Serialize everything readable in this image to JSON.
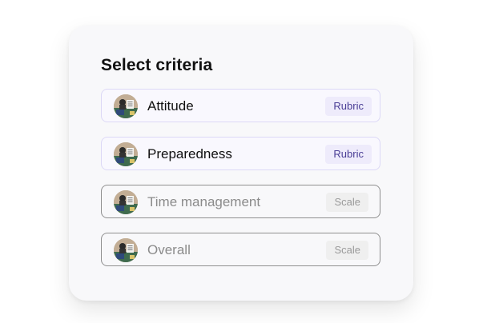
{
  "panel": {
    "title": "Select criteria"
  },
  "criteria": [
    {
      "label": "Attitude",
      "badge": "Rubric",
      "state": "active"
    },
    {
      "label": "Preparedness",
      "badge": "Rubric",
      "state": "active"
    },
    {
      "label": "Time management",
      "badge": "Scale",
      "state": "inactive"
    },
    {
      "label": "Overall",
      "badge": "Scale",
      "state": "inactive"
    }
  ],
  "icons": {
    "row_icon": "criteria-thumbnail-icon"
  },
  "colors": {
    "rubric_badge_bg": "#eeebfb",
    "rubric_badge_text": "#4a3e96",
    "scale_badge_bg": "#efefef",
    "scale_badge_text": "#9a9a9a",
    "active_border": "#dcd8f6",
    "inactive_border": "#8f8f8f"
  }
}
